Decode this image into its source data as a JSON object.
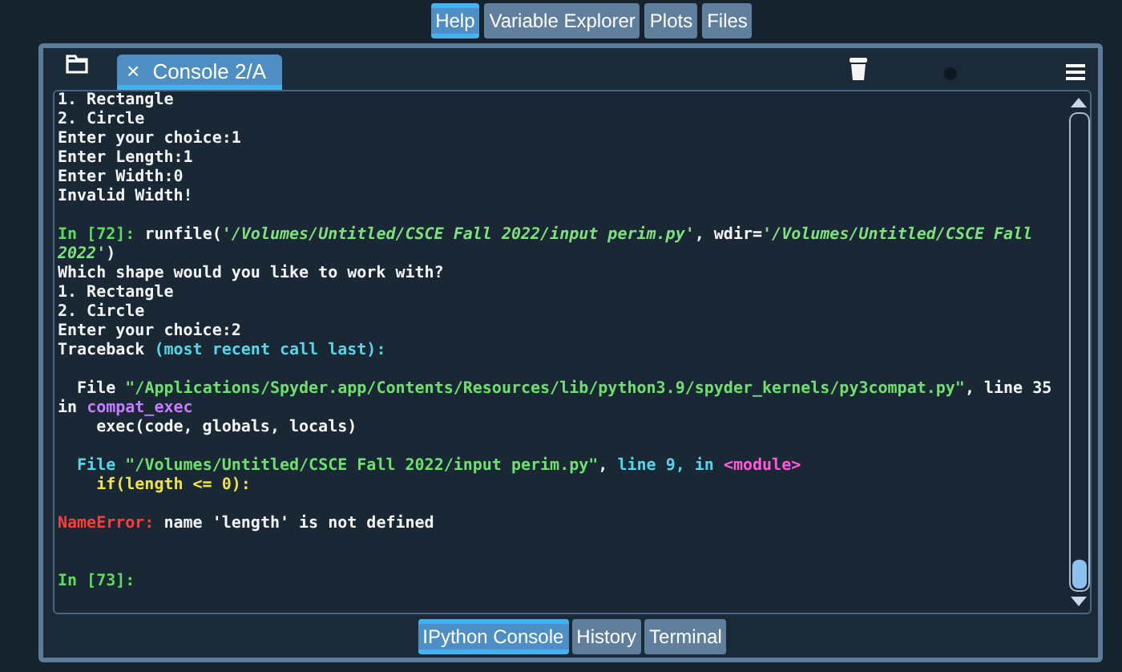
{
  "top_tabs": [
    {
      "label": "Help",
      "selected": true
    },
    {
      "label": "Variable Explorer",
      "selected": false
    },
    {
      "label": "Plots",
      "selected": false
    },
    {
      "label": "Files",
      "selected": false
    }
  ],
  "console_tab": {
    "close": "×",
    "label": "Console 2/A"
  },
  "lines": [
    {
      "kind": "text",
      "spans": [
        {
          "text": "1. Rectangle",
          "kind": "plain"
        }
      ]
    },
    {
      "kind": "text",
      "spans": [
        {
          "text": "2. Circle",
          "kind": "plain"
        }
      ]
    },
    {
      "kind": "text",
      "spans": [
        {
          "text": "Enter your choice:1",
          "kind": "plain"
        }
      ]
    },
    {
      "kind": "text",
      "spans": [
        {
          "text": "Enter Length:1",
          "kind": "plain"
        }
      ]
    },
    {
      "kind": "text",
      "spans": [
        {
          "text": "Enter Width:0",
          "kind": "plain"
        }
      ]
    },
    {
      "kind": "text",
      "spans": [
        {
          "text": "Invalid Width!",
          "kind": "plain"
        }
      ]
    },
    {
      "kind": "blank"
    },
    {
      "kind": "text",
      "spans": [
        {
          "text": "In [72]:",
          "kind": "prompt"
        },
        {
          "text": " runfile(",
          "kind": "plain"
        },
        {
          "text": "'/Volumes/Untitled/CSCE Fall 2022/input perim.py'",
          "kind": "string"
        },
        {
          "text": ", wdir=",
          "kind": "plain"
        },
        {
          "text": "'/Volumes/Untitled/CSCE Fall",
          "kind": "string"
        }
      ]
    },
    {
      "kind": "text",
      "spans": [
        {
          "text": "2022'",
          "kind": "string"
        },
        {
          "text": ")",
          "kind": "plain"
        }
      ]
    },
    {
      "kind": "text",
      "spans": [
        {
          "text": "Which shape would you like to work with?",
          "kind": "plain"
        }
      ]
    },
    {
      "kind": "text",
      "spans": [
        {
          "text": "1. Rectangle",
          "kind": "plain"
        }
      ]
    },
    {
      "kind": "text",
      "spans": [
        {
          "text": "2. Circle",
          "kind": "plain"
        }
      ]
    },
    {
      "kind": "text",
      "spans": [
        {
          "text": "Enter your choice:2",
          "kind": "plain"
        }
      ]
    },
    {
      "kind": "text",
      "spans": [
        {
          "text": "Traceback ",
          "kind": "plain"
        },
        {
          "text": "(most recent call last):",
          "kind": "cyan"
        }
      ]
    },
    {
      "kind": "blank"
    },
    {
      "kind": "text",
      "spans": [
        {
          "text": "  File ",
          "kind": "plain"
        },
        {
          "text": "\"/Applications/Spyder.app/Contents/Resources/lib/python3.9/spyder_kernels/py3compat.py\"",
          "kind": "path"
        },
        {
          "text": ", line 35",
          "kind": "plain"
        }
      ]
    },
    {
      "kind": "text",
      "spans": [
        {
          "text": "in ",
          "kind": "plain"
        },
        {
          "text": "compat_exec",
          "kind": "purple"
        }
      ]
    },
    {
      "kind": "text",
      "spans": [
        {
          "text": "    exec(code, globals, locals)",
          "kind": "plain"
        }
      ]
    },
    {
      "kind": "blank"
    },
    {
      "kind": "text",
      "spans": [
        {
          "text": "  File ",
          "kind": "cyan"
        },
        {
          "text": "\"/Volumes/Untitled/CSCE Fall 2022/input perim.py\"",
          "kind": "path"
        },
        {
          "text": ", ",
          "kind": "plain"
        },
        {
          "text": "line 9, in ",
          "kind": "cyan"
        },
        {
          "text": "<module>",
          "kind": "magenta"
        }
      ]
    },
    {
      "kind": "text",
      "spans": [
        {
          "text": "    if(length <= 0):",
          "kind": "yellow"
        }
      ]
    },
    {
      "kind": "blank"
    },
    {
      "kind": "text",
      "spans": [
        {
          "text": "NameError:",
          "kind": "error"
        },
        {
          "text": " name 'length' is not defined",
          "kind": "plain"
        }
      ]
    },
    {
      "kind": "blank"
    },
    {
      "kind": "blank"
    },
    {
      "kind": "text",
      "spans": [
        {
          "text": "In [73]:",
          "kind": "prompt"
        }
      ]
    }
  ],
  "bottom_tabs": [
    {
      "label": "IPython Console",
      "selected": true
    },
    {
      "label": "History",
      "selected": false
    },
    {
      "label": "Terminal",
      "selected": false
    }
  ]
}
